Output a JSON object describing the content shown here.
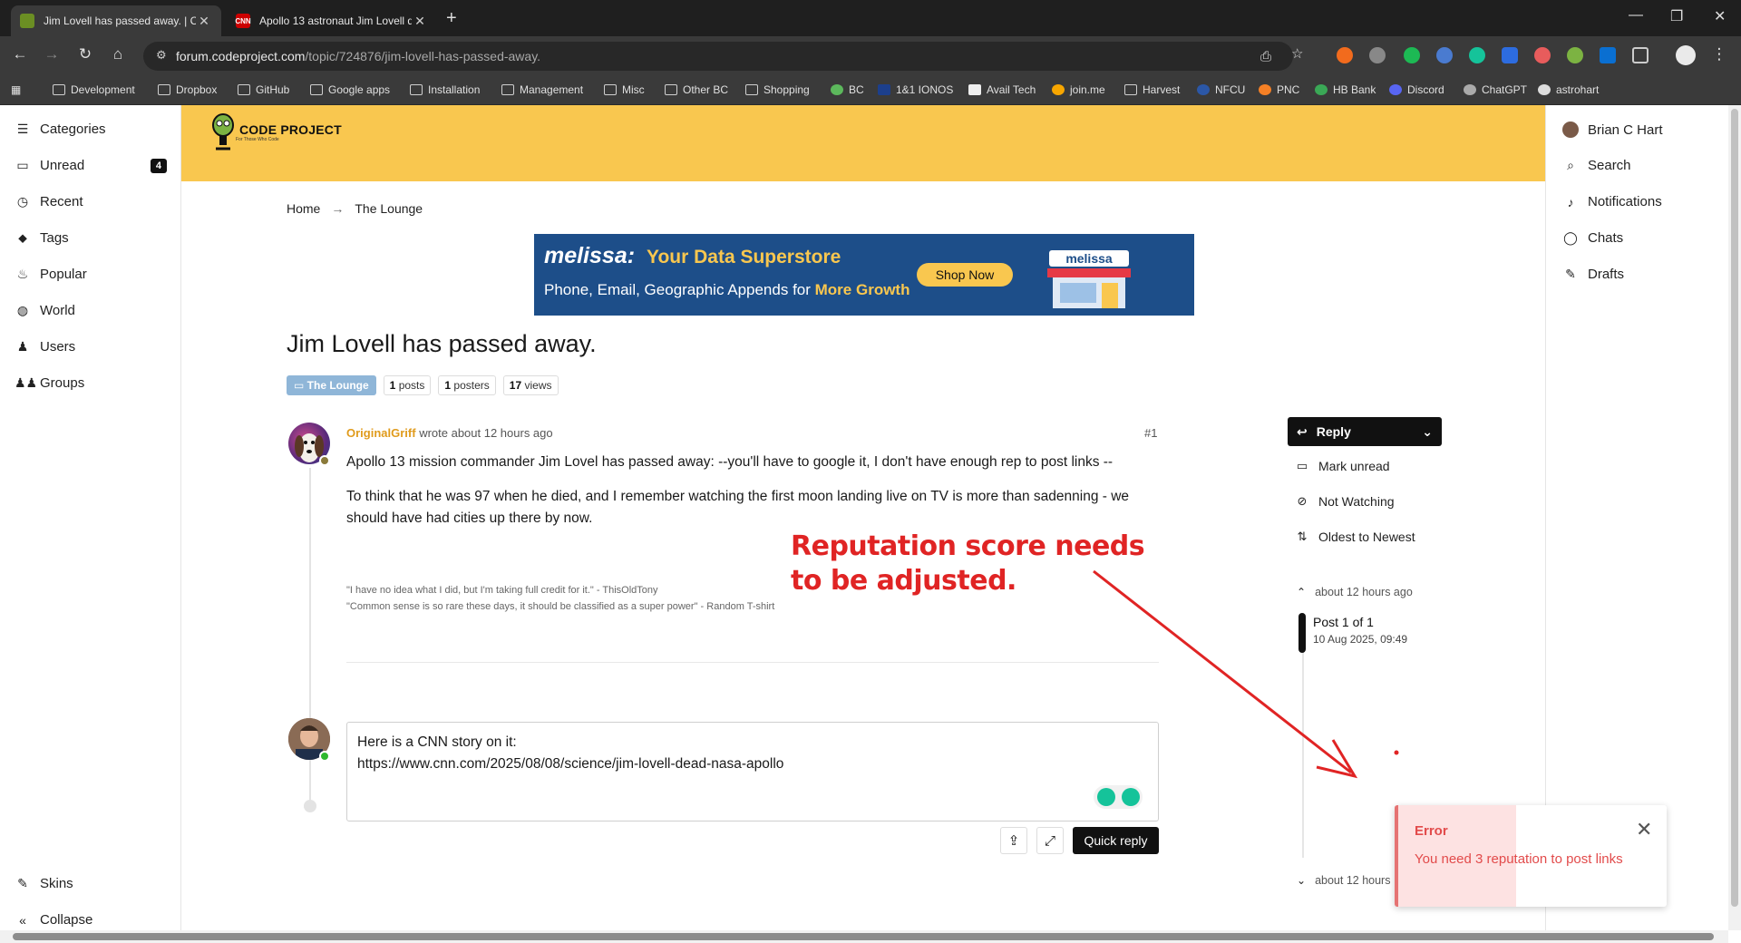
{
  "browser": {
    "tabs": [
      {
        "title": "Jim Lovell has passed away. | Cc",
        "active": true
      },
      {
        "title": "Apollo 13 astronaut Jim Lovell d",
        "active": false,
        "favicon_text": "CNN"
      }
    ],
    "url_host": "forum.codeproject.com",
    "url_path": "/topic/724876/jim-lovell-has-passed-away.",
    "bookmarks": [
      "Development",
      "Dropbox",
      "GitHub",
      "Google apps",
      "Installation",
      "Management",
      "Misc",
      "Other BC",
      "Shopping",
      "BC",
      "1&1 IONOS",
      "Avail Tech",
      "join.me",
      "Harvest",
      "NFCU",
      "PNC",
      "HB Bank",
      "Discord",
      "ChatGPT",
      "astrohart"
    ]
  },
  "leftnav": {
    "items": [
      {
        "label": "Categories",
        "icon": "list-icon"
      },
      {
        "label": "Unread",
        "icon": "inbox-icon",
        "badge": "4"
      },
      {
        "label": "Recent",
        "icon": "clock-icon"
      },
      {
        "label": "Tags",
        "icon": "tags-icon"
      },
      {
        "label": "Popular",
        "icon": "fire-icon"
      },
      {
        "label": "World",
        "icon": "globe-icon"
      },
      {
        "label": "Users",
        "icon": "user-icon"
      },
      {
        "label": "Groups",
        "icon": "users-icon"
      }
    ],
    "skins": "Skins",
    "collapse": "Collapse"
  },
  "rightnav": {
    "user": "Brian C Hart",
    "search": "Search",
    "notifications": "Notifications",
    "chats": "Chats",
    "drafts": "Drafts"
  },
  "brand": {
    "name": "CODE PROJECT",
    "tagline": "For Those Who Code"
  },
  "breadcrumb": {
    "home": "Home",
    "current": "The Lounge"
  },
  "ad": {
    "brand": "melissa:",
    "headline": "Your Data Superstore",
    "sub_prefix": "Phone, Email, Geographic Appends for",
    "sub_highlight": "More Growth",
    "cta": "Shop Now",
    "store_sign": "melissa"
  },
  "topic": {
    "title": "Jim Lovell has passed away.",
    "category": "The Lounge",
    "posts": "1",
    "posts_label": "posts",
    "posters": "1",
    "posters_label": "posters",
    "views": "17",
    "views_label": "views"
  },
  "post": {
    "author": "OriginalGriff",
    "meta": "wrote about 12 hours ago",
    "number": "#1",
    "paragraphs": [
      "Apollo 13 mission commander Jim Lovel has passed away: --you'll have to google it, I don't have enough rep to post links --",
      "To think that he was 97 when he died, and I remember watching the first moon landing live on TV is more than sadenning - we should have had cities up there by now."
    ],
    "signature": [
      "\"I have no idea what I did, but I'm taking full credit for it.\" - ThisOldTony",
      "\"Common sense is so rare these days, it should be classified as a super power\" - Random T-shirt"
    ]
  },
  "annotation": {
    "line1": "Reputation score needs",
    "line2": "to be adjusted.",
    "color": "#e02424"
  },
  "composer": {
    "line1": "Here is a CNN story on it:",
    "line2": "https://www.cnn.com/2025/08/08/science/jim-lovell-dead-nasa-apollo",
    "quick_reply": "Quick reply"
  },
  "sidebar": {
    "reply": "Reply",
    "mark_unread": "Mark unread",
    "not_watching": "Not Watching",
    "sort": "Oldest to Newest",
    "time_top": "about 12 hours ago",
    "post_count": "Post 1 of 1",
    "post_date": "10 Aug 2025, 09:49",
    "time_bottom": "about 12 hours"
  },
  "toast": {
    "title": "Error",
    "message": "You need 3 reputation to post links",
    "color": "#e24b4b"
  }
}
